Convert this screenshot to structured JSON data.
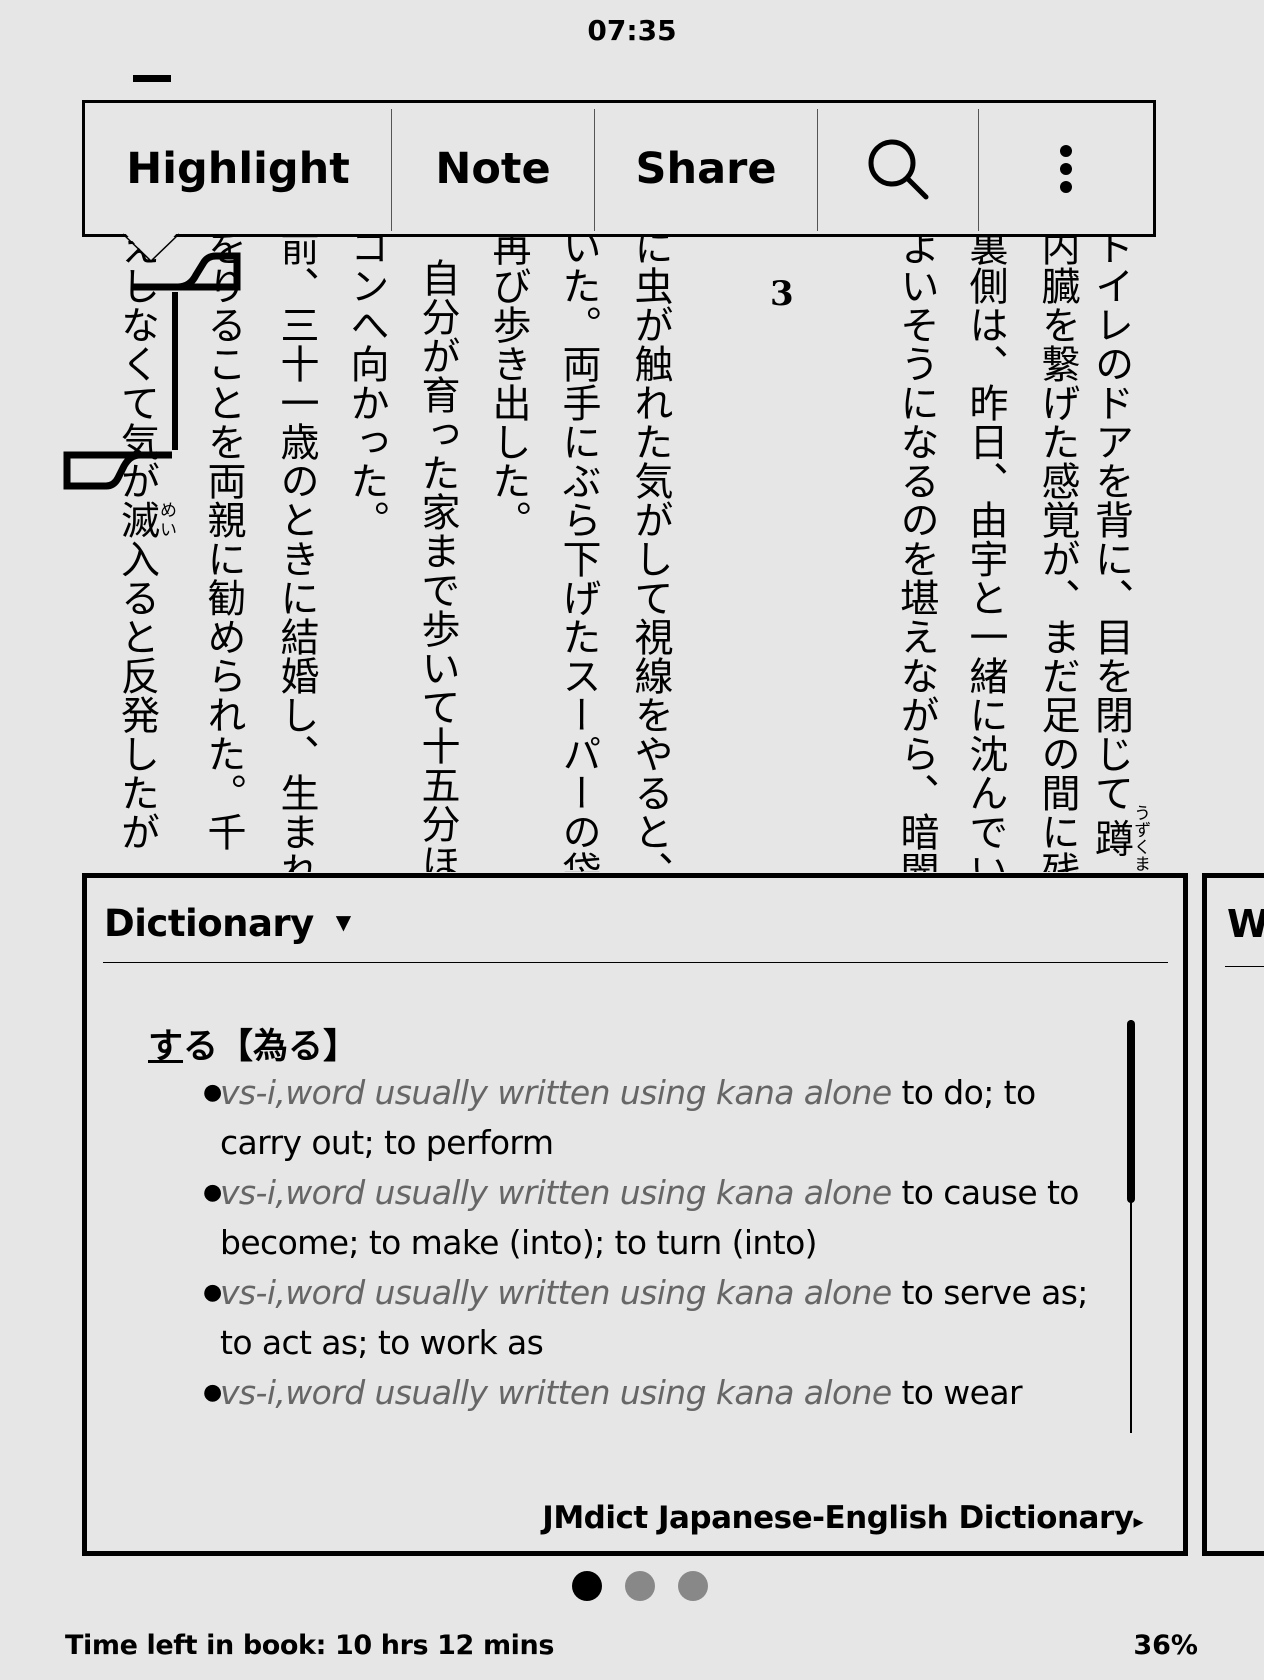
{
  "status": {
    "clock": "07:35"
  },
  "book": {
    "chapter_number": "3",
    "columns": [
      {
        "pre": "トイレのドアを背に、目を閉じて",
        "base": "蹲",
        "rt": "うずくま",
        "post": ""
      },
      {
        "pre": "内臓を繋げた感覚が、まだ足の間に残"
      },
      {
        "pre": "裏側は、昨日、由宇と一緒に沈んでい"
      },
      {
        "pre": "よいそうになるのを堪えながら、暗闇"
      },
      {
        "pre": "に虫が触れた気がして視線をやると、"
      },
      {
        "pre": "いた。両手にぶら下げたスーパーの袋"
      },
      {
        "pre": "再び歩き出した。"
      },
      {
        "pre": "自分が育った家まで歩いて十五分ほ"
      },
      {
        "pre": "コンへ向かった。"
      },
      {
        "pre": "前、三十一歳のときに結婚し、生まれ"
      },
      {
        "pre": "をりることを両親に勧められた。千"
      },
      {
        "pre": "えしなくて気が",
        "base": "滅",
        "rt": "めい",
        "post": "入ると反発したが"
      }
    ]
  },
  "toolbar": {
    "highlight": "Highlight",
    "note": "Note",
    "share": "Share",
    "search_icon": "search-icon",
    "more_icon": "more-vertical-icon"
  },
  "dictionary": {
    "title": "Dictionary",
    "caret": "▼",
    "headword_underlined": "す",
    "headword_rest": "る【為る】",
    "definitions": [
      {
        "pos": "vs-i,word usually written using kana alone",
        "gloss": "to do; to carry out; to perform"
      },
      {
        "pos": "vs-i,word usually written using kana alone",
        "gloss": "to cause to become; to make (into); to turn (into)"
      },
      {
        "pos": "vs-i,word usually written using kana alone",
        "gloss": "to serve as; to act as; to work as"
      },
      {
        "pos": "vs-i,word usually written using kana alone",
        "gloss": "to wear"
      }
    ],
    "source": "JMdict Japanese-English Dictionary",
    "source_arrow": "▸"
  },
  "next_panel": {
    "title_partial": "W"
  },
  "pager": {
    "count": 3,
    "active": 1
  },
  "footer": {
    "time_left": "Time left in book: 10 hrs 12 mins",
    "percent": "36%"
  },
  "colors": {
    "background": "#e6e6e6",
    "inactive_dot": "#888888",
    "pos_text": "#666666"
  }
}
